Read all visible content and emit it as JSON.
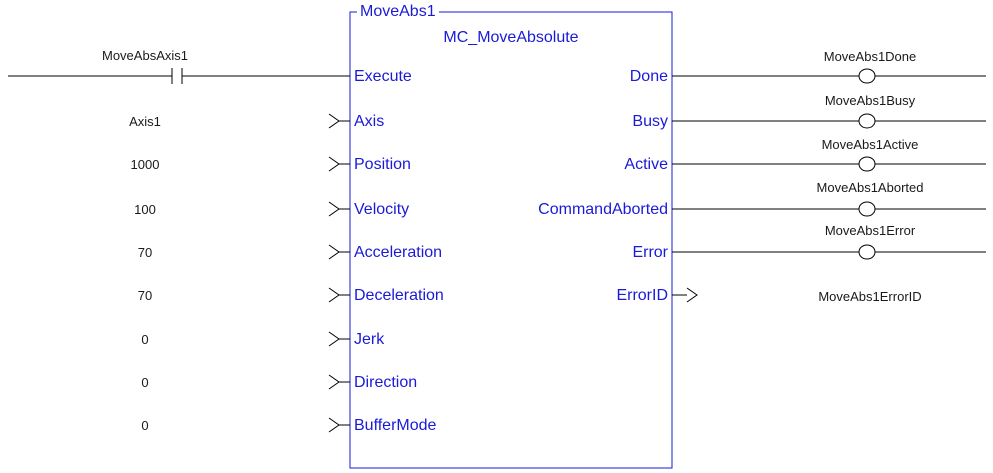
{
  "block": {
    "instance_name": "MoveAbs1",
    "type_name": "MC_MoveAbsolute",
    "color": "#1a1ad8"
  },
  "inputs": [
    {
      "pin": "Execute",
      "variable": "MoveAbsAxis1",
      "kind": "contact"
    },
    {
      "pin": "Axis",
      "variable": "Axis1",
      "kind": "value"
    },
    {
      "pin": "Position",
      "variable": "1000",
      "kind": "value"
    },
    {
      "pin": "Velocity",
      "variable": "100",
      "kind": "value"
    },
    {
      "pin": "Acceleration",
      "variable": "70",
      "kind": "value"
    },
    {
      "pin": "Deceleration",
      "variable": "70",
      "kind": "value"
    },
    {
      "pin": "Jerk",
      "variable": "0",
      "kind": "value"
    },
    {
      "pin": "Direction",
      "variable": "0",
      "kind": "value"
    },
    {
      "pin": "BufferMode",
      "variable": "0",
      "kind": "value"
    }
  ],
  "outputs": [
    {
      "pin": "Done",
      "variable": "MoveAbs1Done",
      "kind": "coil"
    },
    {
      "pin": "Busy",
      "variable": "MoveAbs1Busy",
      "kind": "coil"
    },
    {
      "pin": "Active",
      "variable": "MoveAbs1Active",
      "kind": "coil"
    },
    {
      "pin": "CommandAborted",
      "variable": "MoveAbs1Aborted",
      "kind": "coil"
    },
    {
      "pin": "Error",
      "variable": "MoveAbs1Error",
      "kind": "coil"
    },
    {
      "pin": "ErrorID",
      "variable": "MoveAbs1ErrorID",
      "kind": "value"
    }
  ]
}
